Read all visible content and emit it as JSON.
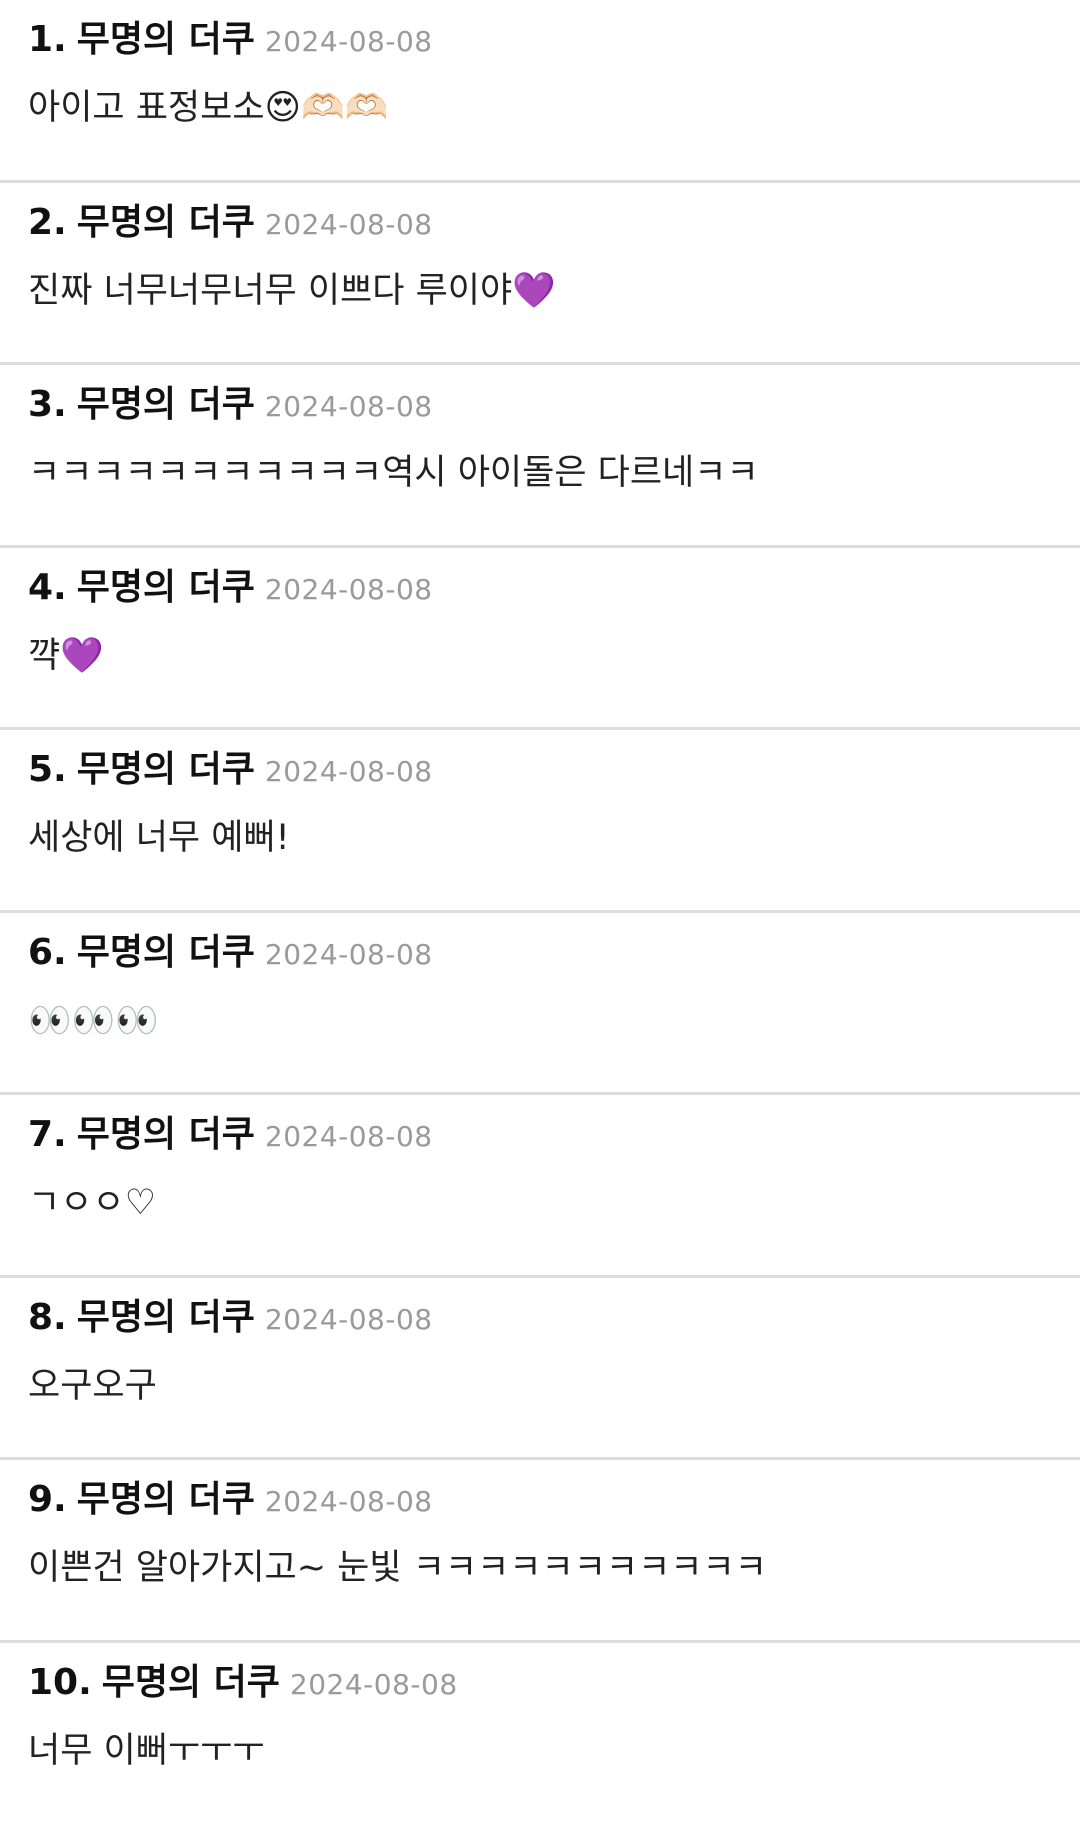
{
  "comments": [
    {
      "index": "1.",
      "author": "무명의 더쿠",
      "date": "2024-08-08",
      "text": "아이고 표정보소😍🫶🏻🫶🏻"
    },
    {
      "index": "2.",
      "author": "무명의 더쿠",
      "date": "2024-08-08",
      "text": "진짜 너무너무너무 이쁘다 루이야💜"
    },
    {
      "index": "3.",
      "author": "무명의 더쿠",
      "date": "2024-08-08",
      "text": "ㅋㅋㅋㅋㅋㅋㅋㅋㅋㅋㅋ역시 아이돌은 다르네ㅋㅋ"
    },
    {
      "index": "4.",
      "author": "무명의 더쿠",
      "date": "2024-08-08",
      "text": "꺅💜"
    },
    {
      "index": "5.",
      "author": "무명의 더쿠",
      "date": "2024-08-08",
      "text": "세상에 너무 예뻐!"
    },
    {
      "index": "6.",
      "author": "무명의 더쿠",
      "date": "2024-08-08",
      "text": "👀👀👀"
    },
    {
      "index": "7.",
      "author": "무명의 더쿠",
      "date": "2024-08-08",
      "text": "ㄱㅇㅇ♡"
    },
    {
      "index": "8.",
      "author": "무명의 더쿠",
      "date": "2024-08-08",
      "text": "오구오구"
    },
    {
      "index": "9.",
      "author": "무명의 더쿠",
      "date": "2024-08-08",
      "text": "이쁜건 알아가지고~ 눈빛 ㅋㅋㅋㅋㅋㅋㅋㅋㅋㅋㅋ"
    },
    {
      "index": "10.",
      "author": "무명의 더쿠",
      "date": "2024-08-08",
      "text": "너무 이뻐ㅜㅜㅜ"
    }
  ]
}
